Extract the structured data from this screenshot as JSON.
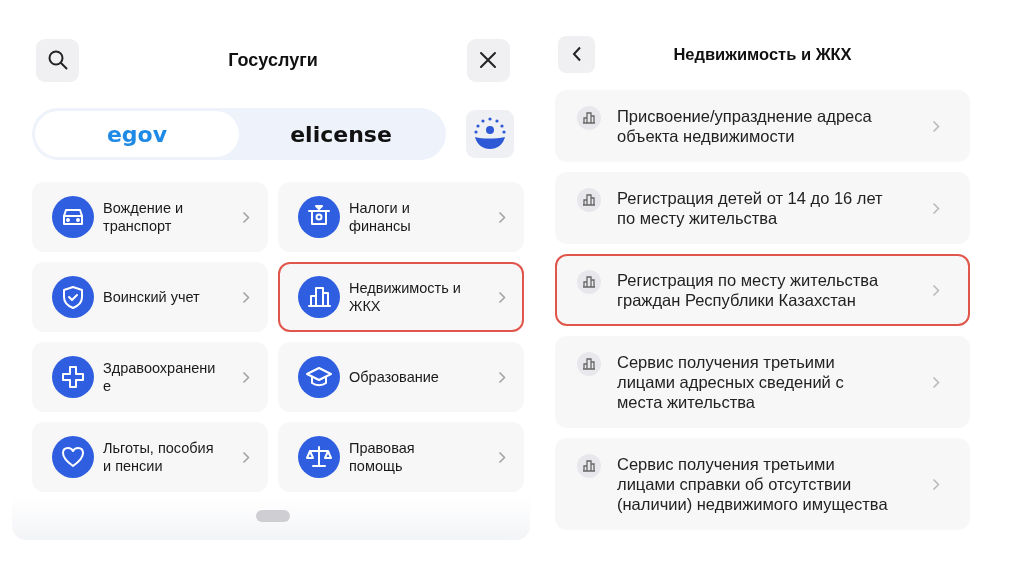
{
  "catalog": {
    "title": "Госуслуги",
    "portals": [
      {
        "label": "egov",
        "selected": true
      },
      {
        "label": "elicense",
        "selected": false
      }
    ],
    "categories": [
      {
        "kind": "car",
        "label": "Вождение и транспорт",
        "highlighted": false
      },
      {
        "kind": "tax",
        "label": "Налоги и финансы",
        "highlighted": false
      },
      {
        "kind": "shield",
        "label": "Воинский учет",
        "highlighted": false
      },
      {
        "kind": "building",
        "label": "Недвижимость и ЖКХ",
        "highlighted": true
      },
      {
        "kind": "medical",
        "label": "Здравоохранени е",
        "highlighted": false
      },
      {
        "kind": "education",
        "label": "Образование",
        "highlighted": false
      },
      {
        "kind": "heart",
        "label": "Льготы, пособия и пенсии",
        "highlighted": false
      },
      {
        "kind": "law",
        "label": "Правовая помощь",
        "highlighted": false
      }
    ]
  },
  "services": {
    "title": "Недвижимость и ЖКХ",
    "items": [
      {
        "label": "Присвоение/упразднение адреса объекта недвижимости",
        "highlighted": false
      },
      {
        "label": "Регистрация детей от 14 до 16 лет по месту жительства",
        "highlighted": false
      },
      {
        "label": "Регистрация по месту жительства граждан Республики Казахстан",
        "highlighted": true
      },
      {
        "label": "Сервис получения третьими лицами адресных сведений с места жительства",
        "highlighted": false
      },
      {
        "label": "Сервис получения третьими лицами справки об отсутствии (наличии) недвижимого имущества",
        "highlighted": false
      }
    ]
  }
}
